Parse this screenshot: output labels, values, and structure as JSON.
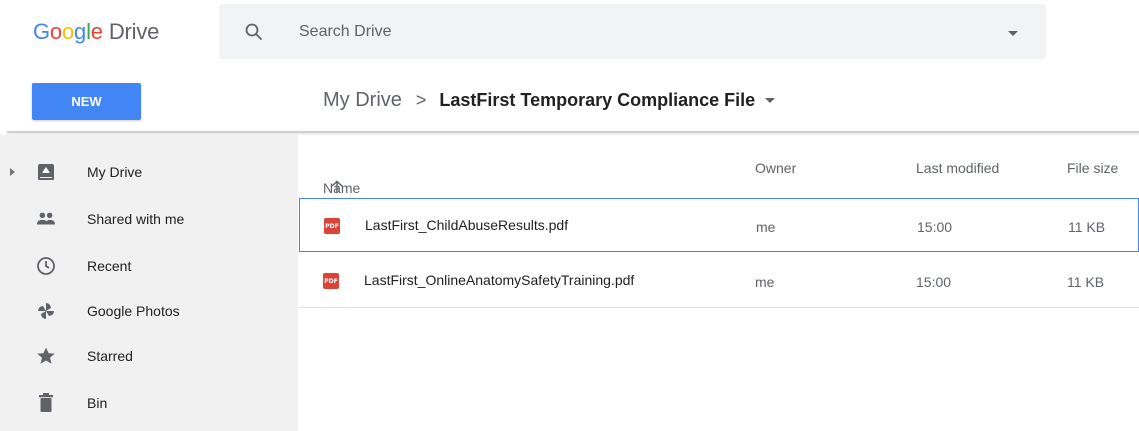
{
  "header": {
    "logo_google_letters": [
      "G",
      "o",
      "o",
      "g",
      "l",
      "e"
    ],
    "logo_product": "Drive",
    "search_placeholder": "Search Drive"
  },
  "toolbar": {
    "new_label": "NEW"
  },
  "breadcrumb": {
    "root": "My Drive",
    "separator": ">",
    "current": "LastFirst Temporary Compliance File"
  },
  "sidebar": {
    "items": [
      {
        "label": "My Drive",
        "icon": "my-drive-icon"
      },
      {
        "label": "Shared with me",
        "icon": "people-icon"
      },
      {
        "label": "Recent",
        "icon": "clock-icon"
      },
      {
        "label": "Google Photos",
        "icon": "pinwheel-icon"
      },
      {
        "label": "Starred",
        "icon": "star-icon"
      },
      {
        "label": "Bin",
        "icon": "trash-icon"
      }
    ]
  },
  "file_list": {
    "columns": {
      "name": "Name",
      "owner": "Owner",
      "last_modified": "Last modified",
      "file_size": "File size"
    },
    "sort_icon": "arrow-up-icon",
    "rows": [
      {
        "name": "LastFirst_ChildAbuseResults.pdf",
        "owner": "me",
        "modified": "15:00",
        "size": "11 KB",
        "type_badge": "PDF",
        "selected": true
      },
      {
        "name": "LastFirst_OnlineAnatomySafetyTraining.pdf",
        "owner": "me",
        "modified": "15:00",
        "size": "11 KB",
        "type_badge": "PDF",
        "selected": false
      }
    ]
  },
  "colors": {
    "brand_blue": "#4285f4",
    "brand_red": "#ea4335",
    "brand_yellow": "#fbbc05",
    "brand_green": "#34a853",
    "pdf_red": "#db4437",
    "sidebar_bg": "#f1f1f1"
  }
}
